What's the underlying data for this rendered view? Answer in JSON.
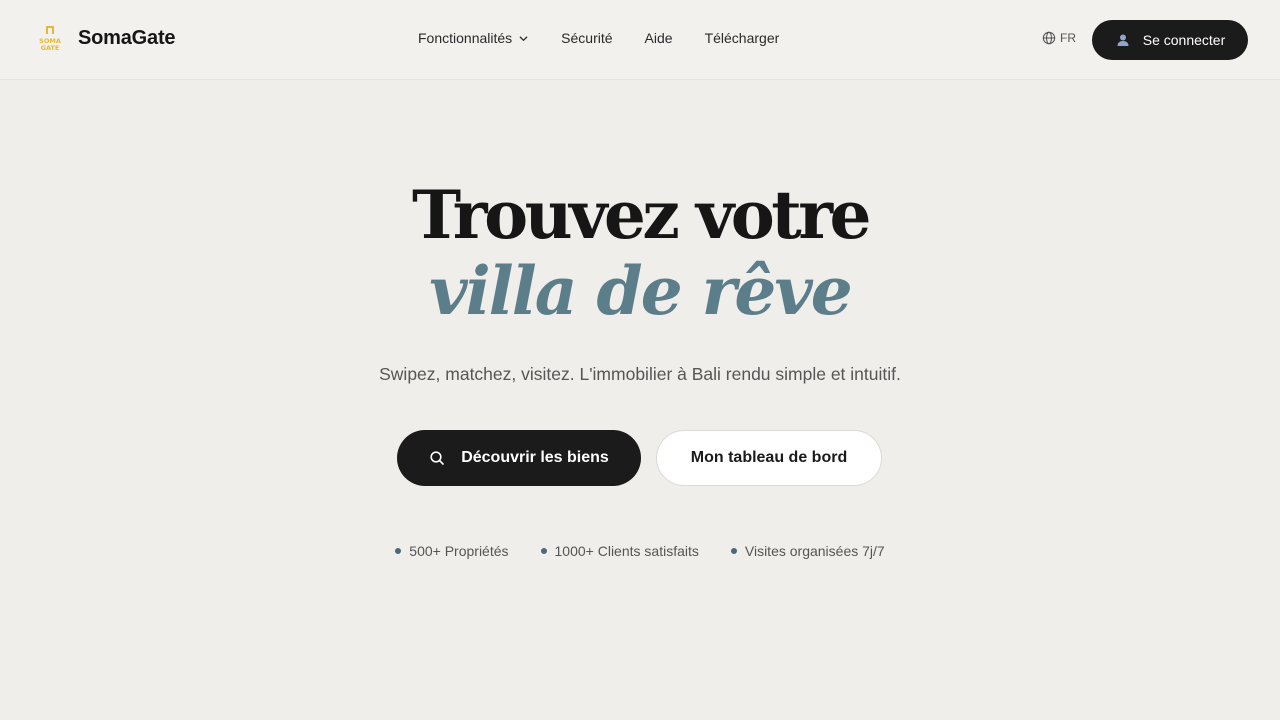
{
  "header": {
    "brand": "SomaGate",
    "logo_text": "SOMA GATE",
    "nav": [
      {
        "label": "Fonctionnalités",
        "has_dropdown": true
      },
      {
        "label": "Sécurité"
      },
      {
        "label": "Aide"
      },
      {
        "label": "Télécharger"
      }
    ],
    "language": "FR",
    "login_label": "Se connecter"
  },
  "hero": {
    "title_line1": "Trouvez votre",
    "title_line2": "villa de rêve",
    "subtitle": "Swipez, matchez, visitez. L'immobilier à Bali rendu simple et intuitif.",
    "cta_primary": "Découvrir les biens",
    "cta_secondary": "Mon tableau de bord",
    "stats": [
      {
        "label": "500+ Propriétés"
      },
      {
        "label": "1000+ Clients satisfaits"
      },
      {
        "label": "Visites organisées 7j/7"
      }
    ]
  },
  "colors": {
    "background": "#f0eeea",
    "accent": "#5c7d8a",
    "dark": "#1b1b1b",
    "logo": "#e2b93b"
  },
  "icons": {
    "nav_dropdown": "chevron-down-icon",
    "language": "globe-icon",
    "login": "user-icon",
    "search": "search-icon"
  }
}
